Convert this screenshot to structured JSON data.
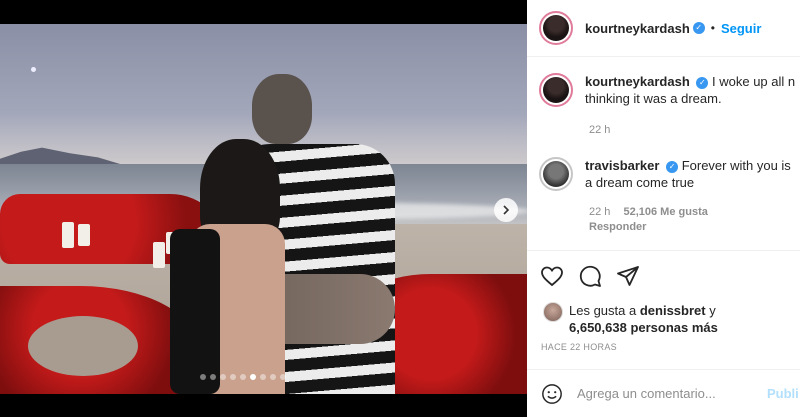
{
  "post": {
    "photo": {
      "carousel_total": 9,
      "carousel_active": 6,
      "next_icon": "chevron-right-icon"
    }
  },
  "header": {
    "username": "kourtneykardash",
    "verified_icon": "verified-badge-icon",
    "separator": "•",
    "follow_label": "Seguir"
  },
  "caption": {
    "username": "kourtneykardash",
    "text_line1": "I woke up all n",
    "text_line2": "thinking it was a dream.",
    "time": "22 h"
  },
  "comments": [
    {
      "username": "travisbarker",
      "text_line1": "Forever with you is",
      "text_line2": "a dream come true",
      "time": "22 h",
      "likes": "52,106 Me gusta",
      "reply": "Responder"
    }
  ],
  "actions": {
    "like_icon": "heart-icon",
    "comment_icon": "comment-icon",
    "share_icon": "send-icon"
  },
  "likes": {
    "prefix": "Les gusta a",
    "user": "denissbret",
    "connector": "y",
    "others": "6,650,638 personas más"
  },
  "timeago": "HACE 22 HORAS",
  "add_comment": {
    "emoji_icon": "smiley-icon",
    "placeholder": "Agrega un comentario...",
    "publish_label": "Publi"
  },
  "colors": {
    "accent": "#0095f6",
    "publish_disabled": "#b2dffc",
    "verified": "#3897f0"
  }
}
